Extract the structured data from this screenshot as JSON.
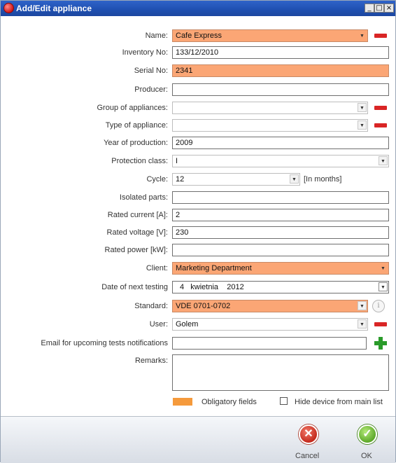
{
  "window": {
    "title": "Add/Edit appliance"
  },
  "colors": {
    "obligatory": "#f59a3c",
    "field_orange": "#fba675"
  },
  "fields": {
    "name": {
      "label": "Name:",
      "value": "Cafe Express"
    },
    "inventory": {
      "label": "Inventory No:",
      "value": "133/12/2010"
    },
    "serial": {
      "label": "Serial No:",
      "value": "2341"
    },
    "producer": {
      "label": "Producer:",
      "value": ""
    },
    "group": {
      "label": "Group of appliances:",
      "value": ""
    },
    "type": {
      "label": "Type of appliance:",
      "value": ""
    },
    "year": {
      "label": "Year of production:",
      "value": "2009"
    },
    "protection": {
      "label": "Protection class:",
      "value": "I"
    },
    "cycle": {
      "label": "Cycle:",
      "value": "12",
      "unit": "[In months]"
    },
    "isolated": {
      "label": "Isolated parts:",
      "value": ""
    },
    "current": {
      "label": "Rated current [A]:",
      "value": "2"
    },
    "voltage": {
      "label": "Rated voltage [V]:",
      "value": "230"
    },
    "power": {
      "label": "Rated power [kW]:",
      "value": ""
    },
    "client": {
      "label": "Client:",
      "value": "Marketing Department"
    },
    "next_test": {
      "label": "Date of next testing",
      "day": "4",
      "month": "kwietnia",
      "year": "2012"
    },
    "standard": {
      "label": "Standard:",
      "value": "VDE 0701-0702"
    },
    "user": {
      "label": "User:",
      "value": "Golem"
    },
    "email": {
      "label": "Email for upcoming tests notifications",
      "value": ""
    },
    "remarks": {
      "label": "Remarks:",
      "value": ""
    }
  },
  "legend": {
    "obligatory_label": "Obligatory fields",
    "hide_label": "Hide device from main list",
    "hide_checked": false
  },
  "footer": {
    "cancel_label": "Cancel",
    "ok_label": "OK"
  },
  "icons": {
    "app": "app-icon",
    "minus": "minus-icon",
    "plus": "plus-icon",
    "info": "info-icon",
    "cancel": "cancel-icon",
    "ok": "check-icon",
    "dropdown": "chevron-down-icon"
  }
}
